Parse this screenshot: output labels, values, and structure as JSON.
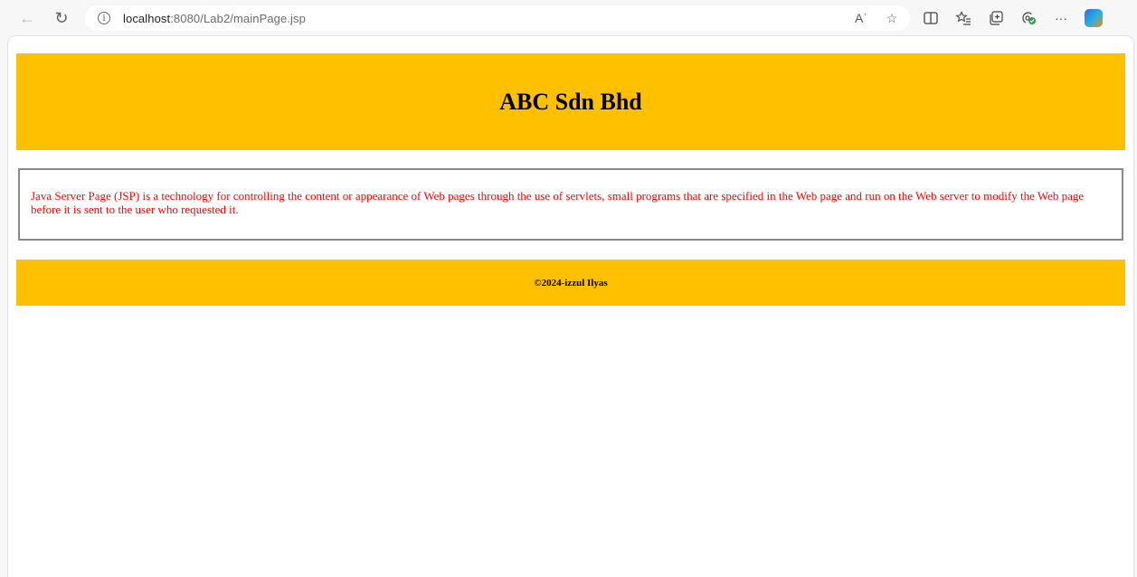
{
  "browser": {
    "address": {
      "host": "localhost",
      "path": ":8080/Lab2/mainPage.jsp"
    },
    "icons": {
      "back": "back-arrow-icon",
      "refresh": "refresh-icon",
      "site_info": "info-icon",
      "read_aloud": "read-aloud-icon",
      "favorite": "star-icon",
      "split_screen": "split-screen-icon",
      "favorites": "favorites-list-icon",
      "collections": "collections-icon",
      "extensions": "extensions-icon",
      "more": "more-options-icon",
      "copilot": "copilot-icon"
    },
    "read_aloud_label": "Aʾ",
    "more_label": "···"
  },
  "page": {
    "header_title": "ABC Sdn Bhd",
    "body_text": "Java Server Page (JSP) is a technology for controlling the content or appearance of Web pages through the use of servlets, small programs that are specified in the Web page and run on the Web server to modify the Web page before it is sent to the user who requested it.",
    "footer_text": "©2024-izzul Ilyas",
    "colors": {
      "band": "#ffc000",
      "body_text": "#ff0000",
      "box_border": "#8a8a8a"
    }
  }
}
